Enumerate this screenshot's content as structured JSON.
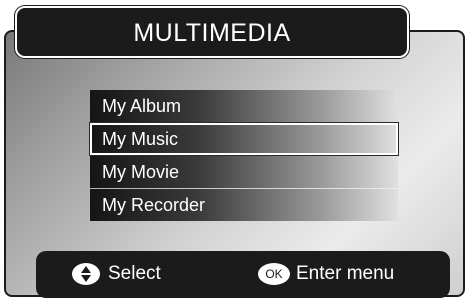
{
  "header": {
    "title": "MULTIMEDIA"
  },
  "menu": {
    "items": [
      {
        "label": "My Album"
      },
      {
        "label": "My Music"
      },
      {
        "label": "My Movie"
      },
      {
        "label": "My Recorder"
      }
    ],
    "selected_label": "My Music"
  },
  "footer": {
    "select_icon": "up-down-arrows-icon",
    "select_label": "Select",
    "ok_icon_text": "OK",
    "enter_label": "Enter menu"
  },
  "colors": {
    "bar_background": "#1b1b1b",
    "text": "#ffffff"
  }
}
